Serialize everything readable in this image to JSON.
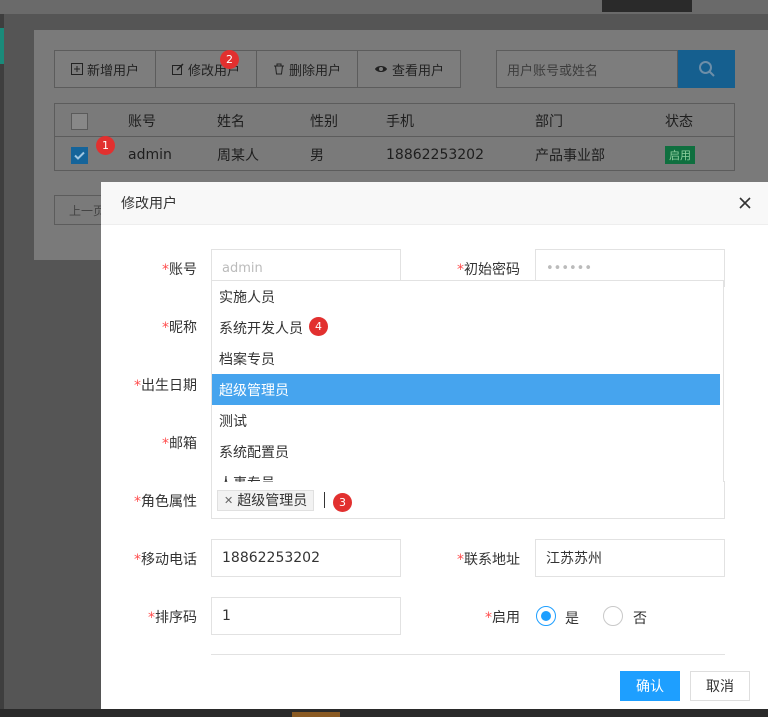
{
  "toolbar": {
    "add_user": "新增用户",
    "edit_user": "修改用户",
    "delete_user": "删除用户",
    "view_user": "查看用户"
  },
  "search": {
    "placeholder": "用户账号或姓名"
  },
  "table": {
    "headers": [
      "账号",
      "姓名",
      "性别",
      "手机",
      "部门",
      "状态"
    ],
    "row": {
      "account": "admin",
      "name": "周某人",
      "gender": "男",
      "phone": "18862253202",
      "dept": "产品事业部",
      "status": "启用"
    }
  },
  "pager": {
    "prev": "上一页"
  },
  "badges": [
    "1",
    "2",
    "3",
    "4"
  ],
  "modal": {
    "title": "修改用户",
    "labels": {
      "account": "账号",
      "init_password": "初始密码",
      "nickname": "昵称",
      "birth_date": "出生日期",
      "email": "邮箱",
      "role": "角色属性",
      "mobile": "移动电话",
      "address": "联系地址",
      "sort": "排序码",
      "enabled": "启用"
    },
    "values": {
      "account": "admin",
      "password": "••••••",
      "mobile": "18862253202",
      "address": "江苏苏州",
      "sort": "1"
    },
    "role_options": [
      "实施人员",
      "系统开发人员",
      "档案专员",
      "超级管理员",
      "测试",
      "系统配置员",
      "人事专员"
    ],
    "selected_role": "超级管理员",
    "enabled_options": {
      "yes": "是",
      "no": "否"
    },
    "enabled_value": "是",
    "ok": "确认",
    "cancel": "取消"
  },
  "colors": {
    "primary": "#1e9fff",
    "selected_option": "#46a4ee",
    "badge": "#e2302f",
    "required": "#ff4d4d"
  }
}
